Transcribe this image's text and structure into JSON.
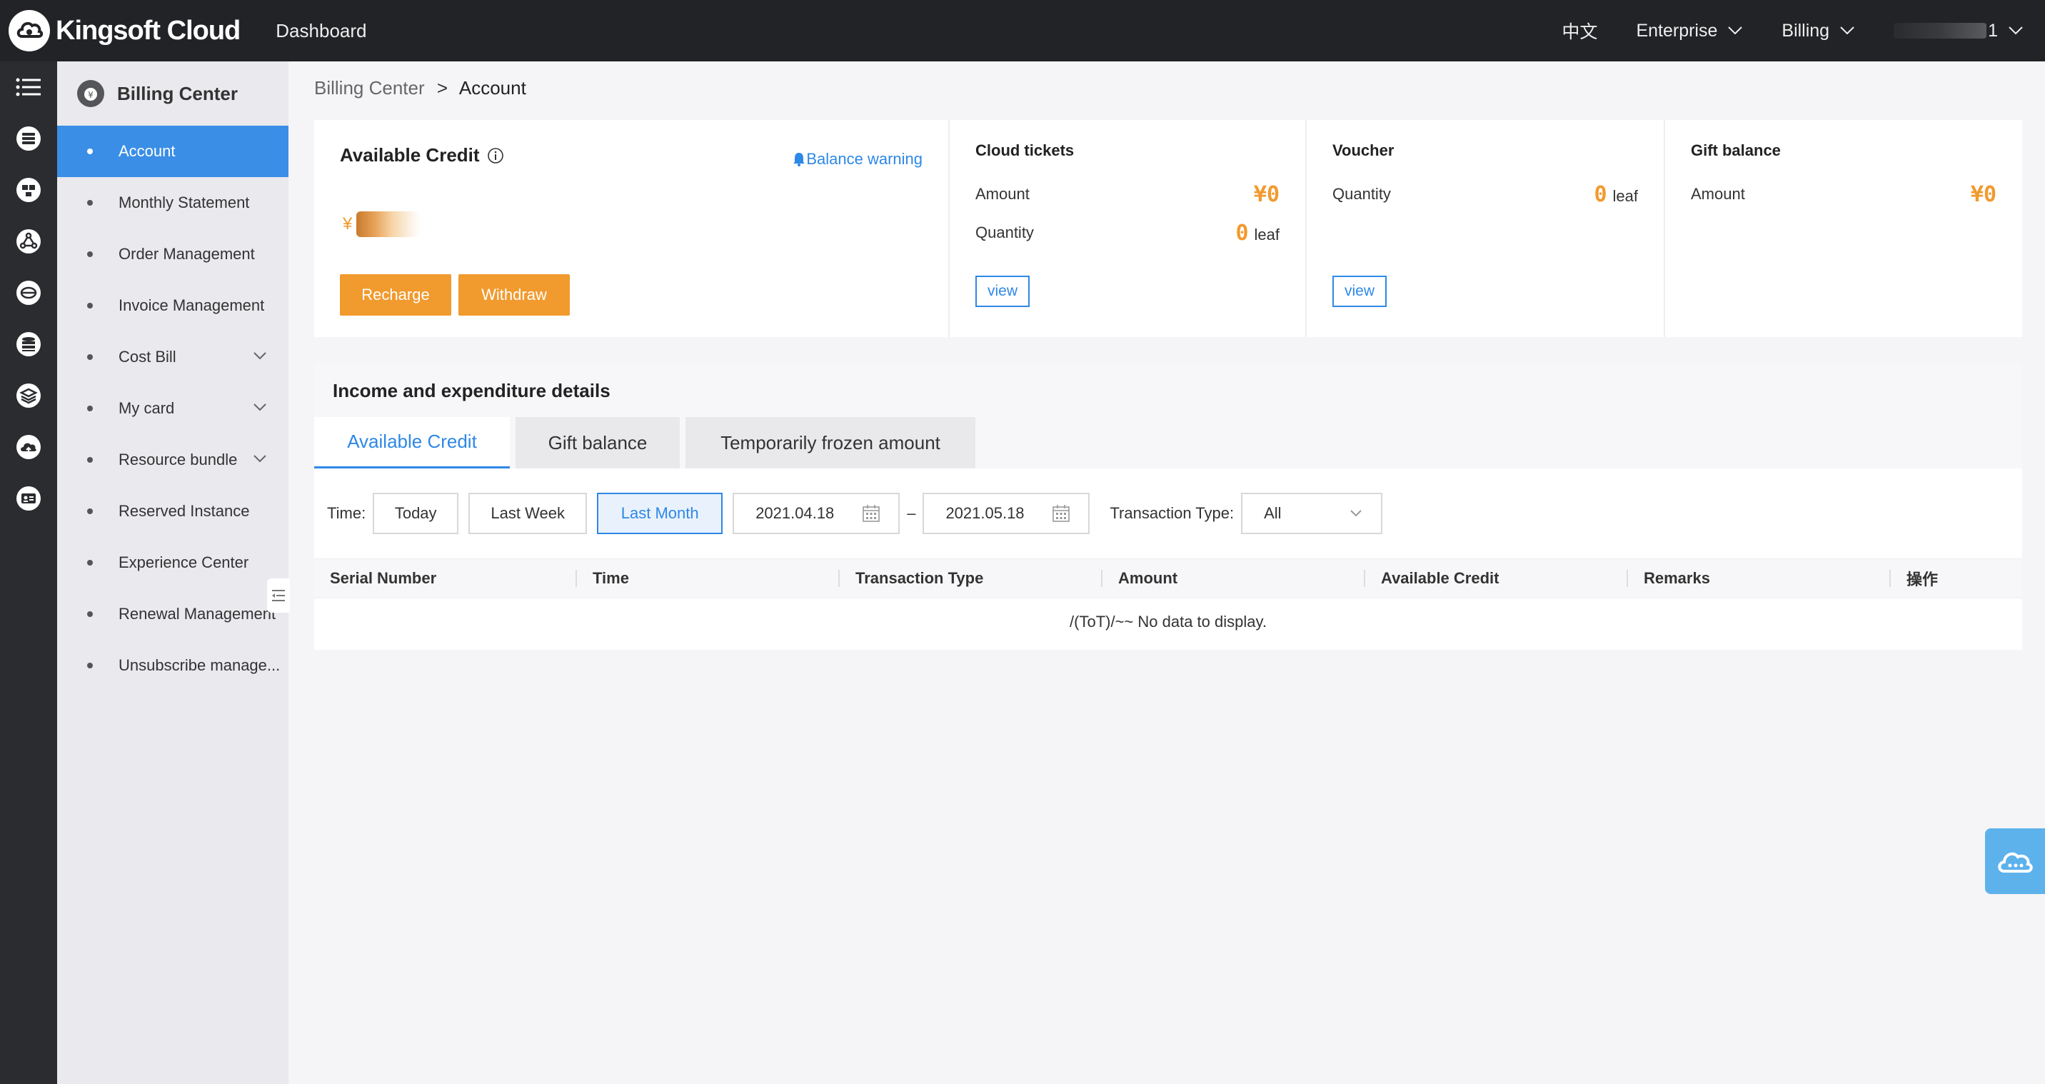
{
  "topbar": {
    "brand": "Kingsoft Cloud",
    "dashboard": "Dashboard",
    "language": "中文",
    "enterprise": "Enterprise",
    "billing": "Billing",
    "user_suffix": "1"
  },
  "rail": {
    "icons": [
      "menu-icon",
      "cloud-server-icon",
      "network-icon",
      "cdn-icon",
      "globe-icon",
      "database-icon",
      "storage-icon",
      "cloud-upload-icon",
      "id-card-icon"
    ]
  },
  "sidebar": {
    "title": "Billing Center",
    "items": [
      {
        "label": "Account",
        "active": true,
        "expandable": false
      },
      {
        "label": "Monthly Statement",
        "active": false,
        "expandable": false
      },
      {
        "label": "Order Management",
        "active": false,
        "expandable": false
      },
      {
        "label": "Invoice Management",
        "active": false,
        "expandable": false
      },
      {
        "label": "Cost Bill",
        "active": false,
        "expandable": true
      },
      {
        "label": "My card",
        "active": false,
        "expandable": true
      },
      {
        "label": "Resource bundle",
        "active": false,
        "expandable": true
      },
      {
        "label": "Reserved Instance",
        "active": false,
        "expandable": false
      },
      {
        "label": "Experience Center",
        "active": false,
        "expandable": false
      },
      {
        "label": "Renewal Management",
        "active": false,
        "expandable": false
      },
      {
        "label": "Unsubscribe manage...",
        "active": false,
        "expandable": false
      }
    ]
  },
  "breadcrumb": {
    "parent": "Billing Center",
    "separator": ">",
    "current": "Account"
  },
  "credit": {
    "title": "Available Credit",
    "balance_warning": "Balance warning",
    "currency": "¥",
    "recharge": "Recharge",
    "withdraw": "Withdraw"
  },
  "tickets": {
    "title": "Cloud tickets",
    "amount_label": "Amount",
    "amount_currency": "¥",
    "amount_value": "0",
    "quantity_label": "Quantity",
    "quantity_value": "0",
    "quantity_unit": "leaf",
    "view": "view"
  },
  "voucher": {
    "title": "Voucher",
    "quantity_label": "Quantity",
    "quantity_value": "0",
    "quantity_unit": "leaf",
    "view": "view"
  },
  "gift": {
    "title": "Gift balance",
    "amount_label": "Amount",
    "amount_currency": "¥",
    "amount_value": "0"
  },
  "details": {
    "title": "Income and expenditure details",
    "tabs": [
      "Available Credit",
      "Gift balance",
      "Temporarily frozen amount"
    ],
    "filter": {
      "time_label": "Time:",
      "today": "Today",
      "last_week": "Last Week",
      "last_month": "Last Month",
      "start_date": "2021.04.18",
      "dash": "–",
      "end_date": "2021.05.18",
      "type_label": "Transaction Type:",
      "type_value": "All"
    },
    "columns": [
      "Serial Number",
      "Time",
      "Transaction Type",
      "Amount",
      "Available Credit",
      "Remarks",
      "操作"
    ],
    "empty": "/(ToT)/~~ No data to display."
  },
  "colors": {
    "accent": "#2e88e6",
    "orange": "#f19a2e",
    "topbar": "#222326"
  }
}
